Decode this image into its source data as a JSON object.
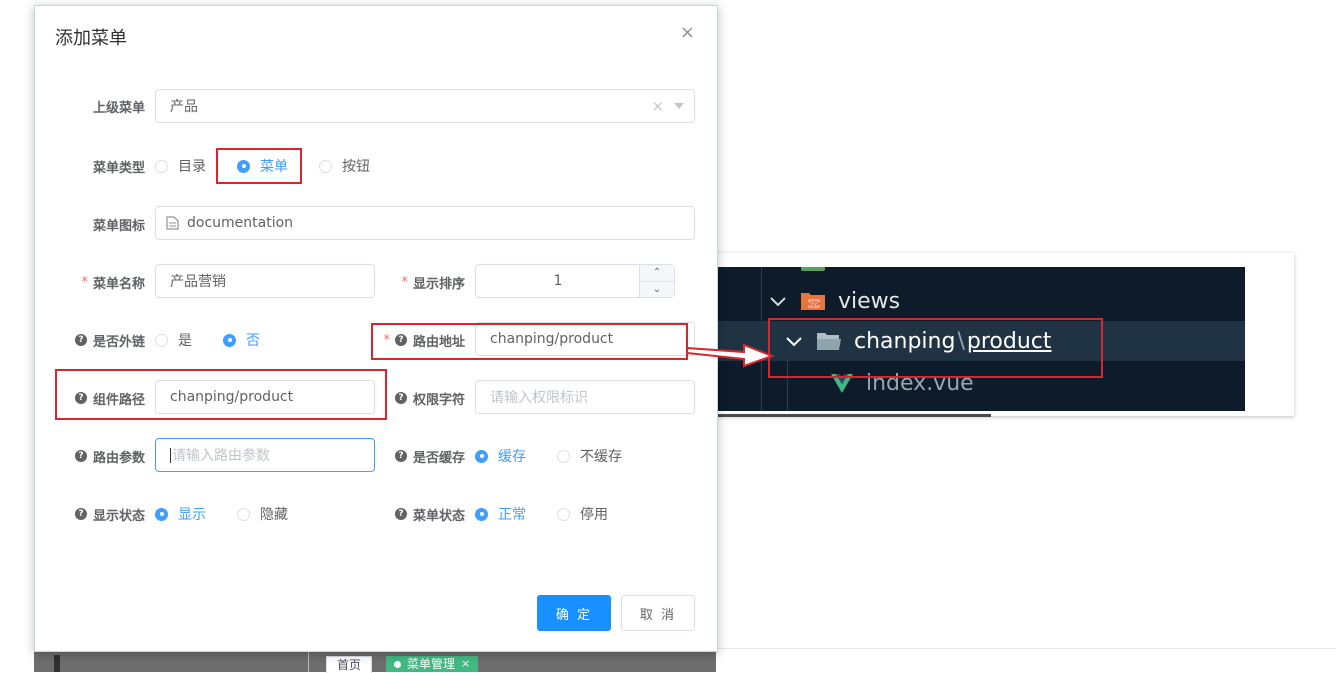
{
  "dialog": {
    "title": "添加菜单",
    "close_glyph": "×",
    "fields": {
      "parent_menu": {
        "label": "上级菜单",
        "value": "产品",
        "clear_glyph": "×"
      },
      "menu_type": {
        "label": "菜单类型",
        "options": [
          "目录",
          "菜单",
          "按钮"
        ],
        "selected": "菜单"
      },
      "menu_icon": {
        "label": "菜单图标",
        "value": "documentation"
      },
      "menu_name": {
        "label": "菜单名称",
        "value": "产品营销"
      },
      "display_order": {
        "label": "显示排序",
        "value": "1"
      },
      "is_external": {
        "label": "是否外链",
        "options": [
          "是",
          "否"
        ],
        "selected": "否"
      },
      "route_path": {
        "label": "路由地址",
        "value": "chanping/product"
      },
      "component_path": {
        "label": "组件路径",
        "value": "chanping/product"
      },
      "permission": {
        "label": "权限字符",
        "placeholder": "请输入权限标识"
      },
      "route_params": {
        "label": "路由参数",
        "placeholder": "请输入路由参数"
      },
      "is_cache": {
        "label": "是否缓存",
        "options": [
          "缓存",
          "不缓存"
        ],
        "selected": "缓存"
      },
      "display_status": {
        "label": "显示状态",
        "options": [
          "显示",
          "隐藏"
        ],
        "selected": "显示"
      },
      "menu_status": {
        "label": "菜单状态",
        "options": [
          "正常",
          "停用"
        ],
        "selected": "正常"
      }
    },
    "buttons": {
      "confirm": "确 定",
      "cancel": "取 消"
    }
  },
  "ide_snippet": {
    "folder_views": "views",
    "folder_path_prefix": "chanping",
    "folder_path_sep": "\\",
    "folder_path_suffix": "product",
    "file": "index.vue"
  },
  "background": {
    "tabs": [
      "首页",
      "菜单管理"
    ],
    "tab_close_glyph": "×"
  },
  "colors": {
    "primary": "#1890ff",
    "radio_active": "#409eff",
    "highlight_red": "#d9252b",
    "required": "#f56c6c",
    "ide_bg": "#0d1b2a",
    "vue_green": "#41b883",
    "folder_orange": "#e8743b"
  }
}
